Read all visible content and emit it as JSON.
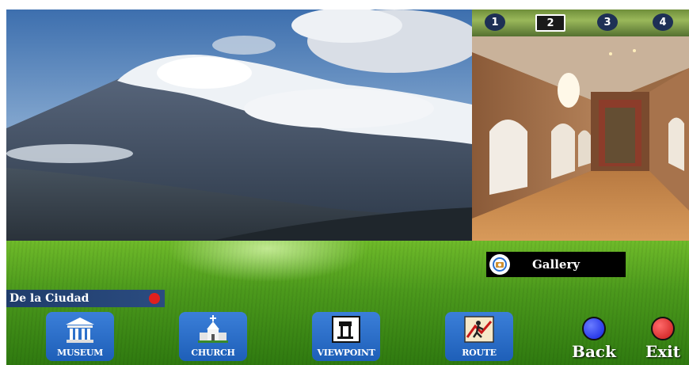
{
  "thumbnails": [
    "1",
    "2",
    "3",
    "4"
  ],
  "active_thumbnail": "2",
  "gallery": {
    "label": "Gallery"
  },
  "location": {
    "name": "De la Ciudad"
  },
  "nav": {
    "museum": "MUSEUM",
    "church": "CHURCH",
    "viewpoint": "VIEWPOINT",
    "route": "ROUTE"
  },
  "controls": {
    "back": "Back",
    "exit": "Exit"
  },
  "colors": {
    "nav_button": "#2a6fcf",
    "location_bar": "#24457a",
    "back_ball": "#1020e0",
    "exit_ball": "#c81818",
    "location_dot": "#e0201e"
  },
  "icons": {
    "museum": "museum-building-icon",
    "church": "church-icon",
    "viewpoint": "binoculars-viewpoint-icon",
    "route": "hiking-route-icon",
    "gallery": "gallery-camera-icon"
  }
}
